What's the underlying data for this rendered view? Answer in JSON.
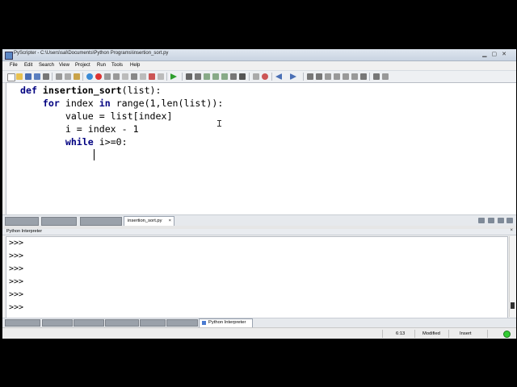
{
  "window": {
    "title": "PyScripter - C:\\Users\\sal\\Documents\\Python Programs\\insertion_sort.py"
  },
  "menu": [
    "File",
    "Edit",
    "Search",
    "View",
    "Project",
    "Run",
    "Tools",
    "Help"
  ],
  "editor": {
    "lines": [
      [
        "def",
        " insertion_sort",
        "(list):"
      ],
      [
        "    for",
        " index ",
        "in",
        " range(1,len(list)):"
      ],
      [
        "        value = list[index]"
      ],
      [
        "        i = index - 1"
      ],
      [
        "        while",
        " i>=0:"
      ]
    ]
  },
  "editor_tab": {
    "label": "insertion_sort.py",
    "close": "×"
  },
  "interpreter": {
    "title": "Python Interpreter",
    "close": "×",
    "prompts": [
      ">>>",
      ">>>",
      ">>>",
      ">>>",
      ">>>",
      ">>>"
    ],
    "tab_label": "Python Interpreter"
  },
  "status": {
    "position": "6:13",
    "modified": "Modified",
    "mode": "Insert"
  }
}
